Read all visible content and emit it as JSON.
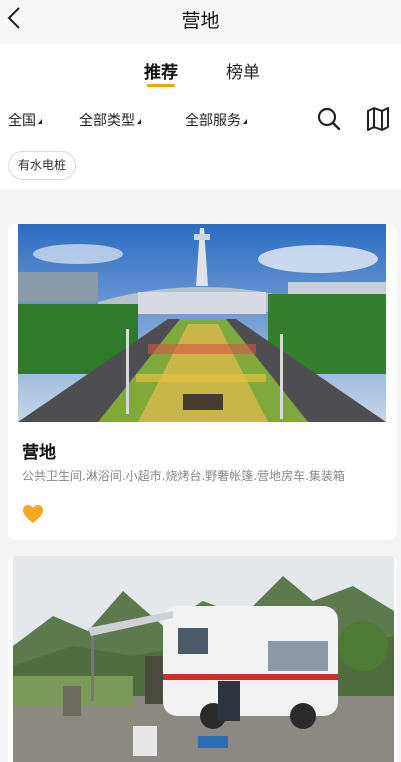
{
  "navbar": {
    "title": "营地",
    "back_icon": "chevron-left-icon"
  },
  "tabs": [
    {
      "label": "推荐",
      "active": true
    },
    {
      "label": "榜单",
      "active": false
    }
  ],
  "filters": [
    {
      "label": "全国"
    },
    {
      "label": "全部类型"
    },
    {
      "label": "全部服务"
    }
  ],
  "toolbar_icons": [
    "search-icon",
    "map-icon"
  ],
  "tags": [
    {
      "label": "有水电桩"
    }
  ],
  "colors": {
    "accent": "#f2a400",
    "heart": "#f5a623",
    "page_bg": "#f4f4f4"
  },
  "cards": [
    {
      "title": "营地",
      "subtitle": "公共卫生间.淋浴间.小超市.烧烤台.野奢帐篷.营地房车.集装箱",
      "favorite_icon": "heart-icon"
    },
    {
      "title": "",
      "subtitle": ""
    }
  ]
}
